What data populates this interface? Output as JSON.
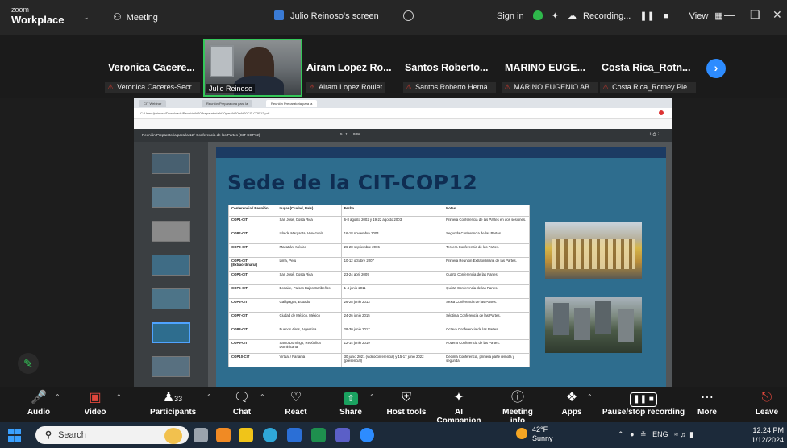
{
  "titlebar": {
    "brand_small": "zoom",
    "brand_big": "Workplace",
    "meeting_label": "Meeting",
    "screen_label": "Julio Reinoso's screen",
    "sign_in": "Sign in",
    "recording": "Recording...",
    "view": "View"
  },
  "participants": [
    {
      "name": "Veronica Cacere...",
      "sub": "Veronica Caceres-Secr..."
    },
    {
      "name": "Airam Lopez Ro...",
      "sub": "Airam Lopez Roulet"
    },
    {
      "name": "Santos Roberto...",
      "sub": "Santos Roberto Hernà..."
    },
    {
      "name": "MARINO EUGE...",
      "sub": "MARINO EUGENIO AB..."
    },
    {
      "name": "Costa Rica_Rotn...",
      "sub": "Costa Rica_Rotney Pie..."
    }
  ],
  "active_speaker": {
    "label": "Julio Reinoso"
  },
  "browser": {
    "tab1": "CIT Webinar",
    "tab2": "Reunión Preparatoria para la",
    "tab3": "Reunión Preparatoria para la",
    "url": "C:/Users/jreinoso/Downloads/Reunión%20Preparatoria%20para%20la%20CIT-COP12.pdf",
    "pdf_title": "Reunión Preparatoria para la 12° Conferencia de las Partes (CIT-COP12)",
    "pdf_page": "5 / 11",
    "pdf_zoom": "93%"
  },
  "slide": {
    "title": "Sede de la CIT-COP12",
    "headers": [
      "Conferencia / Reunión",
      "Lugar (Ciudad, País)",
      "Fecha",
      "Notas"
    ],
    "rows": [
      [
        "COP1-CIT",
        "San José, Costa Rica",
        "6-8 agosto 2002 y 19-22 agosto 2003",
        "Primera Conferencia de las Partes en dos sesiones."
      ],
      [
        "COP2-CIT",
        "Isla de Margarita, Venezuela",
        "16-18 noviembre 2004",
        "Segunda Conferencia de las Partes."
      ],
      [
        "COP3-CIT",
        "Mazatlán, México",
        "26-28 septiembre 2006",
        "Tercera Conferencia de las Partes."
      ],
      [
        "COP4-CIT (Extraordinaria)",
        "Lima, Perú",
        "10-12 octubre 2007",
        "Primera Reunión Extraordinaria de las Partes."
      ],
      [
        "COP4-CIT",
        "San José, Costa Rica",
        "23-24 abril 2009",
        "Cuarta Conferencia de las Partes."
      ],
      [
        "COP5-CIT",
        "Bonaire, Países Bajos Caribeños",
        "1-4 junio 2011",
        "Quinta Conferencia de las Partes."
      ],
      [
        "COP6-CIT",
        "Galápagos, Ecuador",
        "26-28 junio 2013",
        "Sexta Conferencia de las Partes."
      ],
      [
        "COP7-CIT",
        "Ciudad de México, México",
        "24-26 junio 2015",
        "Séptima Conferencia de las Partes."
      ],
      [
        "COP8-CIT",
        "Buenos Aires, Argentina",
        "28-30 junio 2017",
        "Octava Conferencia de las Partes."
      ],
      [
        "COP9-CIT",
        "Santo Domingo, República Dominicana",
        "12-14 junio 2019",
        "Novena Conferencia de las Partes."
      ],
      [
        "COP10-CIT",
        "Virtual / Panamá",
        "30 junio 2021 (videoconferencia) y 15-17 junio 2022 (presencial)",
        "Décima Conferencia, primera parte remota y segunda"
      ]
    ]
  },
  "toolbar": {
    "audio": "Audio",
    "video": "Video",
    "participants": "Participants",
    "participants_count": "33",
    "chat": "Chat",
    "react": "React",
    "share": "Share",
    "host_tools": "Host tools",
    "ai_companion": "AI Companion",
    "meeting_info": "Meeting info",
    "apps": "Apps",
    "pause_recording": "Pause/stop recording",
    "more": "More",
    "leave": "Leave"
  },
  "taskbar": {
    "search": "Search",
    "temp": "42°F",
    "weather": "Sunny",
    "lang": "ENG",
    "time": "12:24 PM",
    "date": "1/12/2024"
  },
  "colors": {
    "accent_blue": "#2d8cff",
    "speaker_green": "#34c759",
    "mic_red": "#e03b2f",
    "slide_bg": "#2e6d8e",
    "slide_title": "#0f2d52"
  }
}
